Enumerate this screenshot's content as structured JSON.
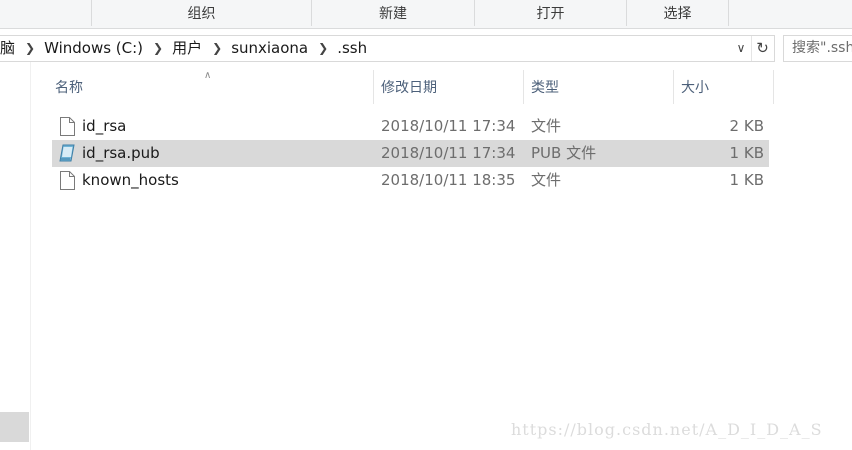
{
  "ribbon": {
    "groups": [
      "组织",
      "新建",
      "打开",
      "选择"
    ]
  },
  "address": {
    "crumbs": [
      "脑",
      "Windows (C:)",
      "用户",
      "sunxiaona",
      ".ssh"
    ],
    "dropdown_icon": "chevron-down-icon",
    "refresh_icon": "refresh-icon"
  },
  "search": {
    "placeholder": "搜索\".ssh\""
  },
  "columns": {
    "name": "名称",
    "date": "修改日期",
    "type": "类型",
    "size": "大小"
  },
  "files": [
    {
      "name": "id_rsa",
      "date": "2018/10/11 17:34",
      "type": "文件",
      "size": "2 KB",
      "icon": "file-icon",
      "selected": false
    },
    {
      "name": "id_rsa.pub",
      "date": "2018/10/11 17:34",
      "type": "PUB 文件",
      "size": "1 KB",
      "icon": "pub-file-icon",
      "selected": true
    },
    {
      "name": "known_hosts",
      "date": "2018/10/11 18:35",
      "type": "文件",
      "size": "1 KB",
      "icon": "file-icon",
      "selected": false
    }
  ],
  "watermark": "https://blog.csdn.net/A_D_I_D_A_S",
  "colors": {
    "ribbon_bg": "#f5f6f7",
    "selected_row": "#d9d9d9",
    "header_text": "#4c607a"
  }
}
